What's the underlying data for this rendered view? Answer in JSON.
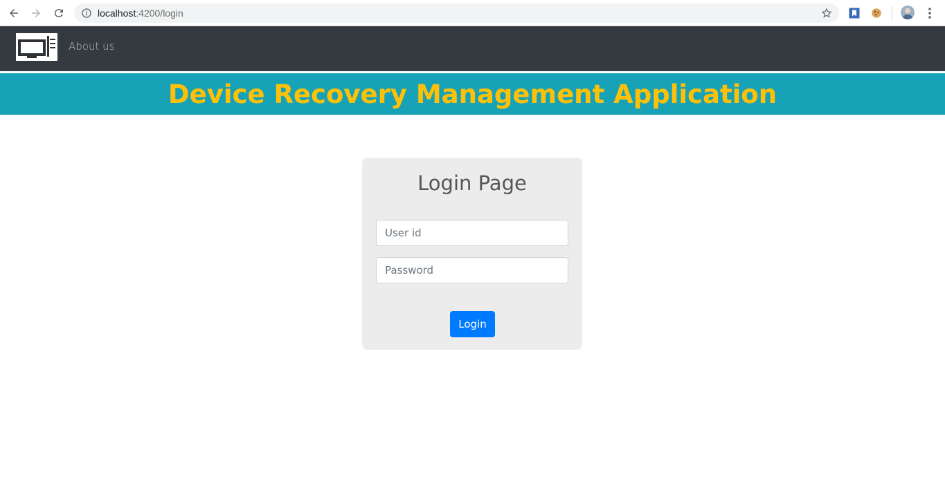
{
  "browser": {
    "url_host": "localhost",
    "url_rest": ":4200/login",
    "back_icon": "arrow-left-icon",
    "forward_icon": "arrow-right-icon",
    "reload_icon": "reload-icon",
    "info_icon": "info-icon",
    "star_icon": "star-icon",
    "menu_icon": "vertical-dots-icon"
  },
  "navbar": {
    "about_label": "About us"
  },
  "banner": {
    "title": "Device Recovery Management Application"
  },
  "login": {
    "heading": "Login Page",
    "userid_placeholder": "User id",
    "password_placeholder": "Password",
    "button_label": "Login"
  },
  "colors": {
    "navbar_bg": "#343a40",
    "banner_bg": "#17a2b8",
    "banner_text": "#ffc107",
    "button_bg": "#007bff",
    "card_bg": "#ececec"
  }
}
